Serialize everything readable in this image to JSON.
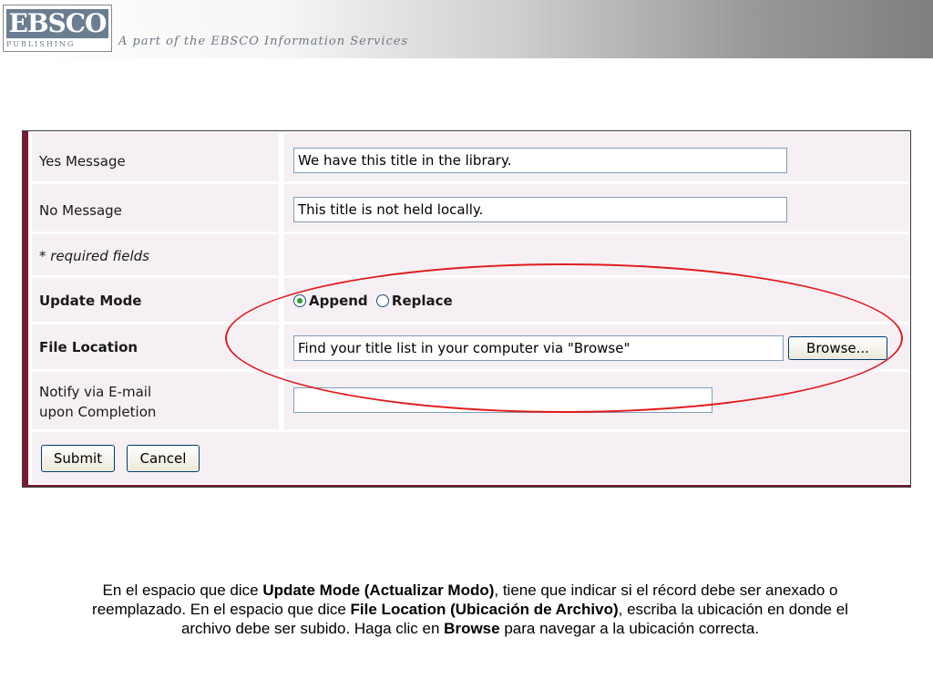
{
  "header": {
    "logo_main": "EBSCO",
    "logo_sub": "PUBLISHING",
    "tagline": "A part of the EBSCO Information Services"
  },
  "form": {
    "yes_message": {
      "label": "Yes Message",
      "value": "We have this title in the library."
    },
    "no_message": {
      "label": "No Message",
      "value": "This title is not held locally."
    },
    "required_note": "* required fields",
    "update_mode": {
      "label": "Update Mode",
      "options": [
        {
          "label": "Append",
          "checked": true
        },
        {
          "label": "Replace",
          "checked": false
        }
      ]
    },
    "file_location": {
      "label": "File Location",
      "value": "Find your title list in your computer via \"Browse\"",
      "browse_label": "Browse..."
    },
    "notify": {
      "label_line1": "Notify via E-mail",
      "label_line2": "upon Completion",
      "value": ""
    },
    "submit_label": "Submit",
    "cancel_label": "Cancel"
  },
  "caption": {
    "p1": "En el espacio que dice ",
    "b1": "Update Mode (Actualizar Modo)",
    "p2": ", tiene que indicar si el récord debe ser anexado o reemplazado. En el espacio que dice ",
    "b2": "File Location (Ubicación de Archivo)",
    "p3": ", escriba la ubicación en donde el archivo debe ser subido. Haga clic en ",
    "b3": "Browse",
    "p4": " para navegar a la ubicación correcta."
  },
  "colors": {
    "accent": "#7a1b33",
    "highlight": "#e11b1b",
    "row_bg": "#f6f0f5"
  }
}
